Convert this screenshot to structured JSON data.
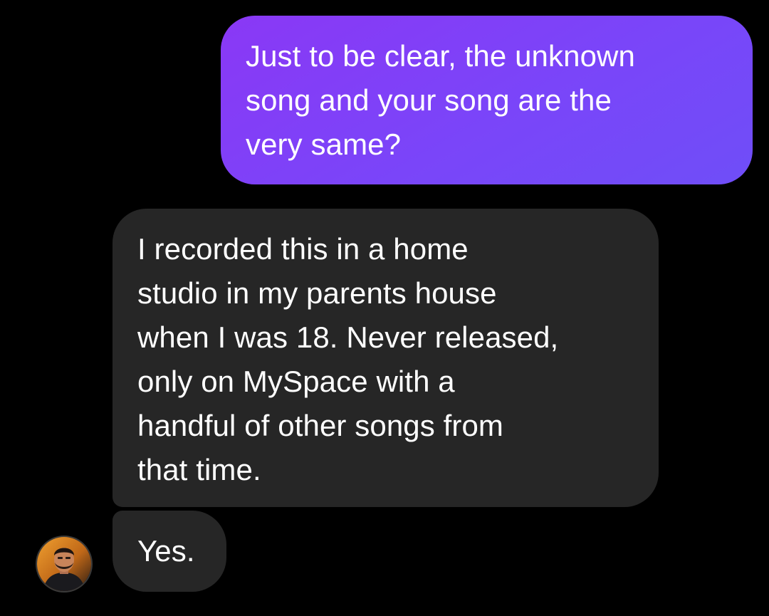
{
  "messages": [
    {
      "direction": "sent",
      "lines": [
        "Just to be clear, the unknown",
        "song and your song are the",
        "very same?"
      ]
    },
    {
      "direction": "received",
      "lines": [
        "I recorded this in a home",
        "studio in my parents house",
        "when I was 18. Never released,",
        "only on MySpace with a",
        "handful of other songs from",
        "that time."
      ]
    },
    {
      "direction": "received",
      "lines": [
        "Yes."
      ]
    }
  ],
  "colors": {
    "background": "#000000",
    "sent_bubble": "#7b44f9",
    "received_bubble": "#262626",
    "text": "#ffffff"
  },
  "icons": {
    "avatar": "contact-avatar"
  }
}
